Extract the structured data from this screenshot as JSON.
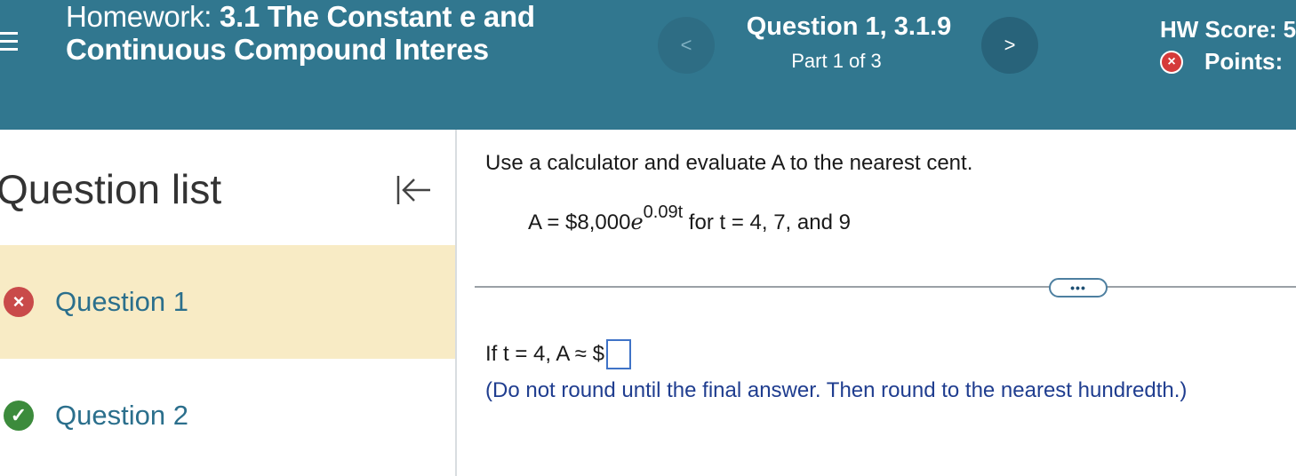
{
  "header": {
    "title_prefix": "Homework: ",
    "title_bold": "3.1 The Constant e and Continuous Compound Interes",
    "question_title": "Question 1, 3.1.9",
    "question_part": "Part 1 of 3",
    "prev_label": "<",
    "next_label": ">",
    "hw_score_label": "HW Score: 5",
    "points_label": "Points:",
    "points_status_icon": "×"
  },
  "sidebar": {
    "title": "Question list",
    "items": [
      {
        "label": "Question 1",
        "status": "incorrect",
        "status_glyph": "×"
      },
      {
        "label": "Question 2",
        "status": "correct",
        "status_glyph": "✓"
      }
    ]
  },
  "main": {
    "instruction": "Use a calculator and evaluate A to the nearest cent.",
    "formula_lhs": "A = $8,000",
    "formula_e": "e",
    "formula_exp": "0.09t",
    "formula_rhs": " for t = 4, 7, and 9",
    "more_label": "•••",
    "answer_prompt": "If t = 4, A ≈ $",
    "hint": "(Do not round until the final answer. Then round to the nearest hundredth.)"
  },
  "colors": {
    "header_bg": "#31778f",
    "active_question_bg": "#f8ebc5",
    "link_blue": "#2b6f8c",
    "hint_blue": "#1f3d8f",
    "incorrect": "#c94a4a",
    "correct": "#3c8b3c"
  }
}
